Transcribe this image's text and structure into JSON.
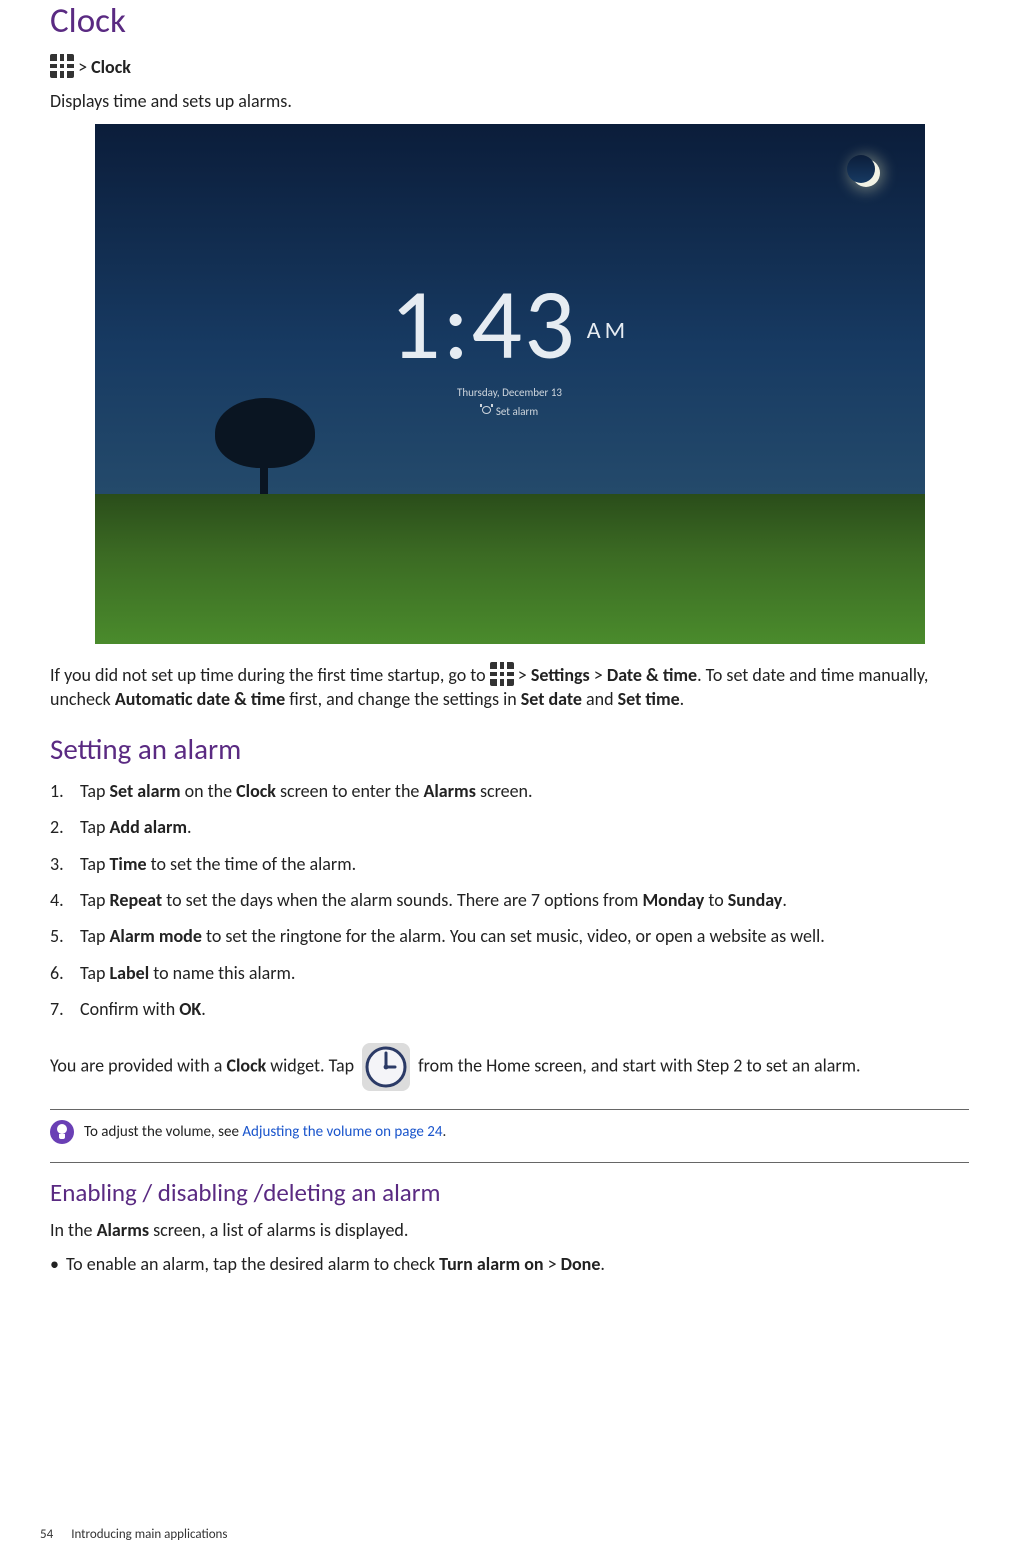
{
  "h1": "Clock",
  "breadcrumb": {
    "sep": " > ",
    "app": "Clock"
  },
  "intro": "Displays time and sets up alarms.",
  "clock_screenshot": {
    "time": "1:43",
    "ampm": "AM",
    "date": "Thursday, December 13",
    "set_alarm": "Set alarm"
  },
  "para_after_screenshot": {
    "pre_icon": "If you did not set up time during the first time startup, go to ",
    "post_icon_1": " > ",
    "b1": "Settings",
    "sep1": " > ",
    "b2": "Date & time",
    "after_b2": ". To set date and time manually, uncheck ",
    "b3": "Automatic date & time",
    "after_b3": " first, and change the settings in ",
    "b4": "Set date",
    "and": " and ",
    "b5": "Set time",
    "end": "."
  },
  "h2_setting_alarm": "Setting an alarm",
  "steps": {
    "n1": "1.",
    "t1_pre": "Tap ",
    "t1_b1": "Set alarm",
    "t1_mid": " on the ",
    "t1_b2": "Clock",
    "t1_mid2": " screen to enter the ",
    "t1_b3": "Alarms",
    "t1_end": " screen.",
    "n2": "2.",
    "t2_pre": "Tap ",
    "t2_b1": "Add alarm",
    "t2_end": ".",
    "n3": "3.",
    "t3_pre": "Tap ",
    "t3_b1": "Time",
    "t3_end": " to set the time of the alarm.",
    "n4": "4.",
    "t4_pre": "Tap ",
    "t4_b1": "Repeat",
    "t4_mid": " to set the days when the alarm sounds. There are 7 options from ",
    "t4_b2": "Monday",
    "t4_to": " to ",
    "t4_b3": "Sunday",
    "t4_end": ".",
    "n5": "5.",
    "t5_pre": "Tap ",
    "t5_b1": "Alarm mode",
    "t5_end": " to set the ringtone for the alarm. You can set music, video, or open a website as well.",
    "n6": "6.",
    "t6_pre": " Tap ",
    "t6_b1": "Label",
    "t6_end": " to name this alarm.",
    "n7": "7.",
    "t7_pre": "Confirm with ",
    "t7_b1": "OK",
    "t7_end": "."
  },
  "widget_para": {
    "pre": "You are provided with a ",
    "b1": "Clock",
    "mid": " widget. Tap ",
    "post": " from the Home screen, and start with Step 2 to set an alarm."
  },
  "tip": {
    "pre": "To adjust the volume, see ",
    "link": "Adjusting the volume on page 24",
    "end": "."
  },
  "h3_enable": "Enabling / disabling /deleting an alarm",
  "enable_intro_pre": "In the ",
  "enable_intro_b": "Alarms",
  "enable_intro_post": " screen, a list of alarms is displayed.",
  "bullet1": {
    "dot": "•",
    "pre": "To enable an alarm, tap the desired alarm to check ",
    "b1": "Turn alarm on",
    "sep": " > ",
    "b2": "Done",
    "end": "."
  },
  "footer": {
    "page": "54",
    "section": "Introducing main applications"
  }
}
